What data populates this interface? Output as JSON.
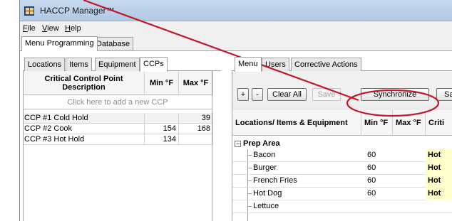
{
  "app": {
    "title": "HACCP Manager™",
    "icon": "haccp-app-icon"
  },
  "menubar": [
    {
      "label": "File",
      "accel": "F",
      "rest": "ile"
    },
    {
      "label": "View",
      "accel": "V",
      "rest": "iew"
    },
    {
      "label": "Help",
      "accel": "H",
      "rest": "elp"
    }
  ],
  "top_tabs": [
    {
      "label": "Menu Programming",
      "active": true
    },
    {
      "label": "Database",
      "active": false
    }
  ],
  "left_tabs": [
    {
      "label": "Locations",
      "active": false
    },
    {
      "label": "Items",
      "active": false
    },
    {
      "label": "Equipment",
      "active": false
    },
    {
      "label": "CCPs",
      "active": true
    }
  ],
  "ccp_grid": {
    "headers": {
      "description": "Critical Control Point Description",
      "min": "Min °F",
      "max": "Max °F"
    },
    "add_placeholder": "Click here to add a new CCP",
    "rows": [
      {
        "description": "CCP #1 Cold Hold",
        "min": "",
        "max": "39"
      },
      {
        "description": "CCP #2 Cook",
        "min": "154",
        "max": "168"
      },
      {
        "description": "CCP #3 Hot Hold",
        "min": "134",
        "max": ""
      }
    ]
  },
  "right_tabs": [
    {
      "label": "Menu",
      "active": true
    },
    {
      "label": "Users",
      "active": false
    },
    {
      "label": "Corrective Actions",
      "active": false
    }
  ],
  "toolbar": {
    "expand_label": "+",
    "collapse_label": "-",
    "clear_all_label": "Clear All",
    "save_label": "Save",
    "synchronize_label": "Synchronize",
    "extra_label": "Sa"
  },
  "menu_grid": {
    "headers": {
      "location": "Locations/ Items & Equipment",
      "min": "Min °F",
      "max": "Max °F",
      "crit": "Criti"
    },
    "group": {
      "expander": "−",
      "label": "Prep Area"
    },
    "rows": [
      {
        "name": "Bacon",
        "min": "60",
        "crit": "Hot"
      },
      {
        "name": "Burger",
        "min": "60",
        "crit": "Hot"
      },
      {
        "name": "French Fries",
        "min": "60",
        "crit": "Hot"
      },
      {
        "name": "Hot Dog",
        "min": "60",
        "crit": "Hot"
      },
      {
        "name": "Lettuce",
        "min": "",
        "crit": ""
      }
    ]
  },
  "colors": {
    "annotation": "#c0182d",
    "highlight": "#ffffcc",
    "titlebar": "#c6d9ee"
  }
}
